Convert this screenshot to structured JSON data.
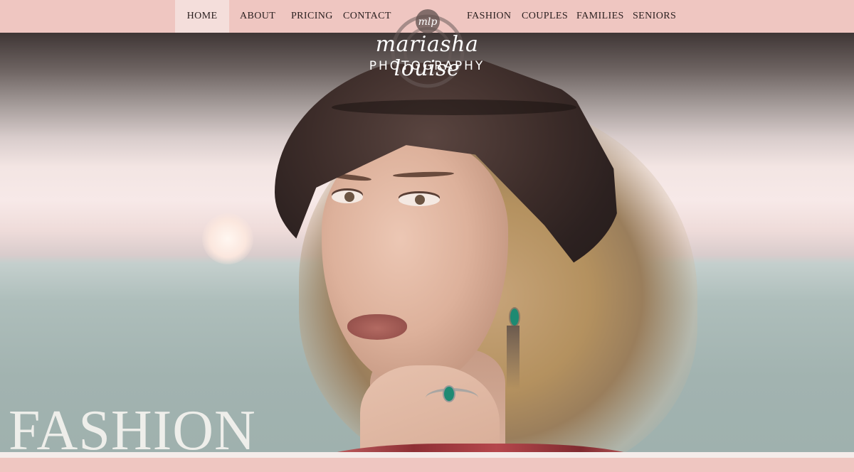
{
  "nav": {
    "left": [
      {
        "label": "HOME",
        "active": true
      },
      {
        "label": "ABOUT"
      },
      {
        "label": "PRICING"
      },
      {
        "label": "CONTACT"
      }
    ],
    "right": [
      {
        "label": "FASHION"
      },
      {
        "label": "COUPLES"
      },
      {
        "label": "FAMILIES"
      },
      {
        "label": "SENIORS"
      }
    ]
  },
  "logo": {
    "monogram": "mlp",
    "script": "mariasha louise",
    "subtitle": "PHOTOGRAPHY"
  },
  "hero": {
    "title": "FASHION"
  },
  "colors": {
    "brand_pink": "#efc6c1",
    "active_tab": "#f4dedb",
    "nav_text": "#2b2020",
    "title_text": "#eeeeea"
  }
}
